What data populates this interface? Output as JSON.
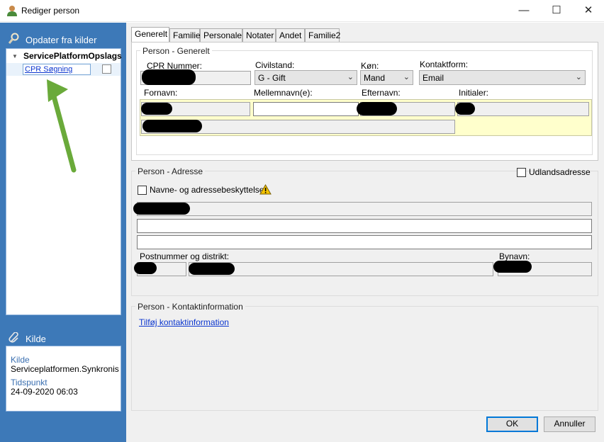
{
  "window": {
    "title": "Rediger person",
    "icon": "person-icon",
    "controls": {
      "minimize": "—",
      "maximize": "☐",
      "close": "✕"
    }
  },
  "left": {
    "sources_header": "Opdater fra kilder",
    "tree": {
      "root_label": "ServicePlatformOpslags",
      "child_label": "CPR Søgning",
      "child_checked": false
    },
    "kilde_header": "Kilde",
    "kilde": {
      "source_label": "Kilde",
      "source_value": "Serviceplatformen.Synkronis...",
      "time_label": "Tidspunkt",
      "time_value": "24-09-2020 06:03"
    }
  },
  "tabs": [
    "Generelt",
    "Familie",
    "Personale",
    "Notater",
    "Andet",
    "Familie2"
  ],
  "active_tab": "Generelt",
  "general": {
    "group_title": "Person - Generelt",
    "cpr_label": "CPR Nummer:",
    "civilstand_label": "Civilstand:",
    "civilstand_value": "G - Gift",
    "koen_label": "Køn:",
    "koen_value": "Mand",
    "kontaktform_label": "Kontaktform:",
    "kontaktform_value": "Email",
    "fornavn_label": "Fornavn:",
    "mellemnavn_label": "Mellemnavn(e):",
    "efternavn_label": "Efternavn:",
    "initialer_label": "Initialer:"
  },
  "address": {
    "group_title": "Person - Adresse",
    "udlands_label": "Udlandsadresse",
    "beskyttelse_label": "Navne- og adressebeskyttelse",
    "warning_icon": "warning-icon",
    "postnr_label": "Postnummer og distrikt:",
    "bynavn_label": "Bynavn:"
  },
  "contact": {
    "group_title": "Person - Kontaktinformation",
    "add_link": "Tilføj kontaktinformation"
  },
  "buttons": {
    "ok": "OK",
    "cancel": "Annuller"
  },
  "colors": {
    "left_pane": "#3d79b8",
    "highlight_row": "#ffffcc",
    "link": "#0b36cf",
    "annotation_arrow": "#6aaa3a"
  }
}
